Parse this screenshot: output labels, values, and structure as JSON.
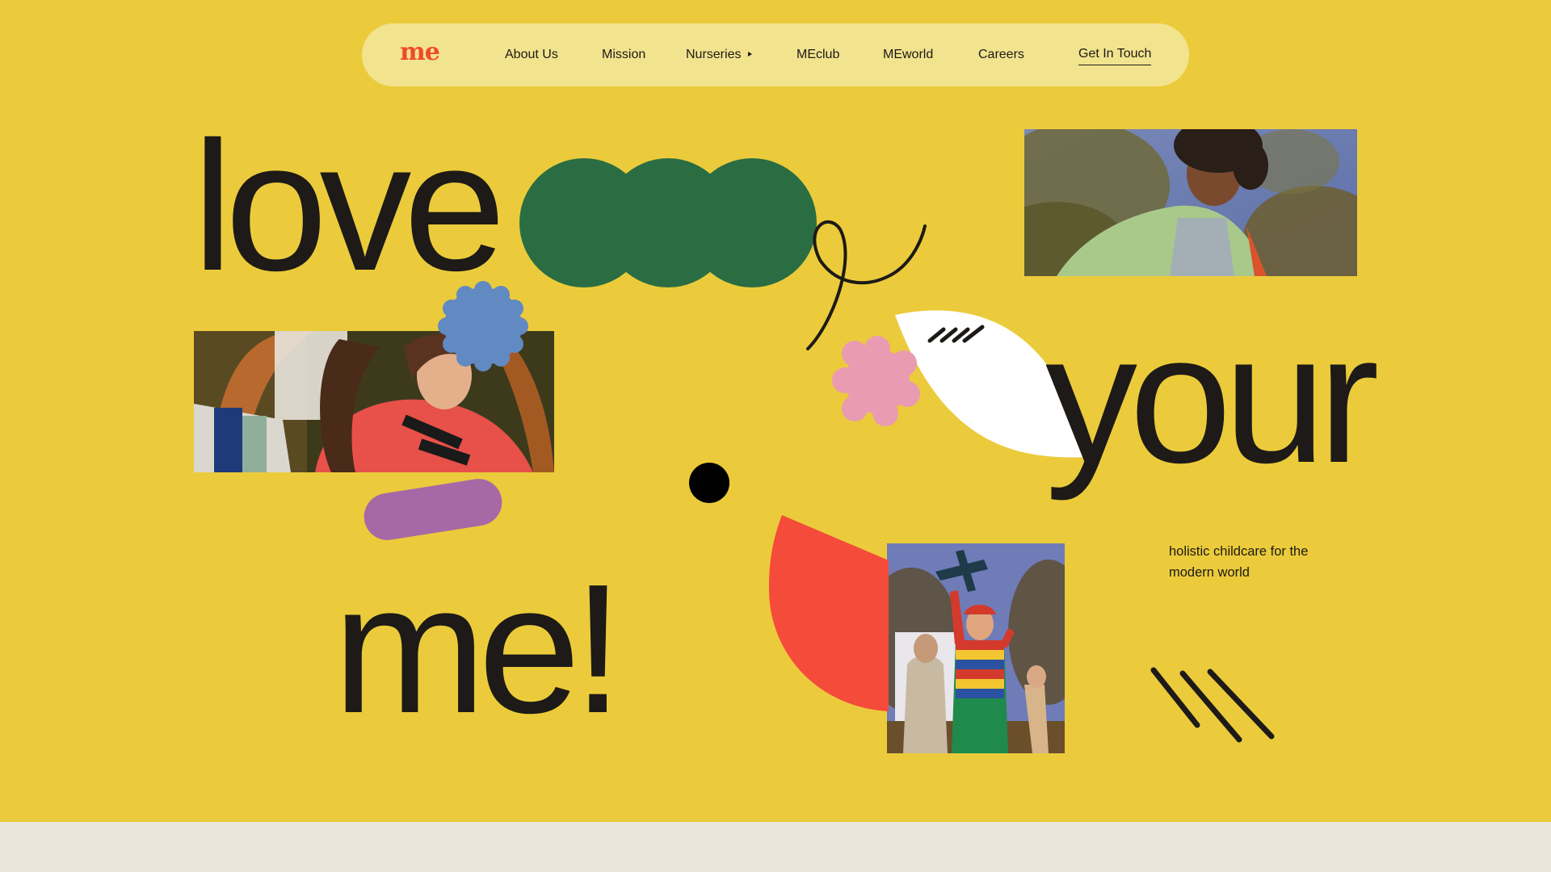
{
  "brand": {
    "logo_text": "me",
    "logo_color": "#F04A2E"
  },
  "nav": {
    "items": [
      {
        "label": "About Us"
      },
      {
        "label": "Mission"
      },
      {
        "label": "Nurseries",
        "has_submenu": true,
        "submenu_icon": "caret-right-icon"
      },
      {
        "label": "MEclub"
      },
      {
        "label": "MEworld"
      },
      {
        "label": "Careers"
      }
    ],
    "cta_label": "Get In Touch"
  },
  "hero": {
    "words": [
      "love",
      "your",
      "me!"
    ],
    "tagline": "holistic childcare for the modern world"
  },
  "colors": {
    "background": "#EBCB3B",
    "nav_background": "#F2E38E",
    "text": "#1D1A17",
    "green": "#2B6D43",
    "blue": "#6189C2",
    "purple": "#A669A5",
    "pink": "#E99BB2",
    "red": "#F54B3A",
    "white": "#FFFFFF",
    "footer_band": "#ECE5DA"
  },
  "images": [
    {
      "name": "child-in-green-jacket-photo"
    },
    {
      "name": "girl-in-red-sweater-photo"
    },
    {
      "name": "boy-with-toy-plane-photo"
    }
  ],
  "decorations": [
    "green-triple-circle-shape",
    "squiggle-line-shape",
    "blue-scalloped-circle-shape",
    "pink-flower-shape",
    "white-leaf-shape",
    "purple-pill-shape",
    "black-dot-shape",
    "red-half-circle-shape",
    "three-stripes-shape"
  ]
}
